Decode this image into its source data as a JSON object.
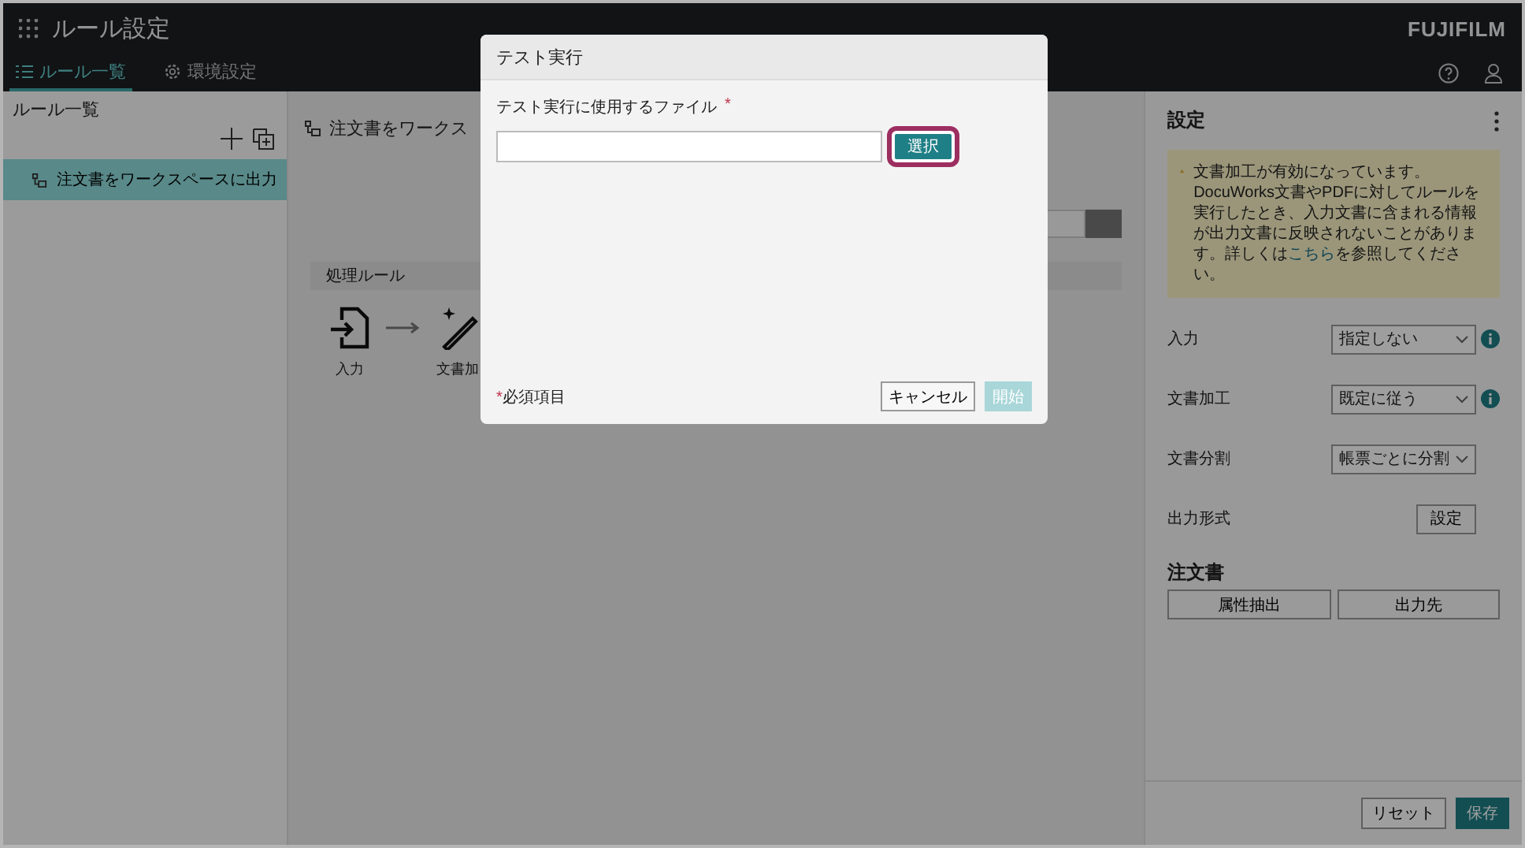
{
  "header": {
    "title": "ルール設定",
    "logo": "FUJIFILM",
    "tabs": [
      {
        "label": "ルール一覧",
        "selected": true,
        "kind": "list"
      },
      {
        "label": "環境設定",
        "selected": false,
        "kind": "gear"
      }
    ]
  },
  "sidebar": {
    "title": "ルール一覧",
    "items": [
      {
        "label": "注文書をワークスペースに出力",
        "selected": true
      }
    ]
  },
  "main": {
    "title": "注文書をワークス",
    "section": "処理ルール",
    "steps": [
      {
        "kind": "input",
        "label": "入力"
      },
      {
        "kind": "process",
        "label": "文書加"
      }
    ]
  },
  "panel": {
    "title": "設定",
    "warning": {
      "before": "文書加工が有効になっています。DocuWorks文書やPDFに対してルールを実行したとき、入力文書に含まれる情報が出力文書に反映されないことがあります。詳しくは",
      "link": "こちら",
      "after": "を参照してください。"
    },
    "rows": [
      {
        "label": "入力",
        "kind": "select",
        "value": "指定しない",
        "info": true
      },
      {
        "label": "文書加工",
        "kind": "select",
        "value": "既定に従う",
        "info": true
      },
      {
        "label": "文書分割",
        "kind": "select",
        "value": "帳票ごとに分割",
        "info": false
      },
      {
        "label": "出力形式",
        "kind": "button",
        "value": "設定",
        "info": false
      }
    ],
    "group": {
      "title": "注文書",
      "buttons": [
        "属性抽出",
        "出力先"
      ]
    },
    "footer": [
      {
        "label": "リセット",
        "primary": false
      },
      {
        "label": "保存",
        "primary": true
      }
    ]
  },
  "dialog": {
    "title": "テスト実行",
    "field": {
      "label": "テスト実行に使用するファイル",
      "required_mark": "*",
      "button": "選択",
      "highlighted": true
    },
    "note": {
      "mark": "*",
      "text": "必須項目"
    },
    "buttons": [
      {
        "label": "キャンセル",
        "disabled": false,
        "primary": false
      },
      {
        "label": "開始",
        "disabled": true,
        "primary": true
      }
    ]
  }
}
